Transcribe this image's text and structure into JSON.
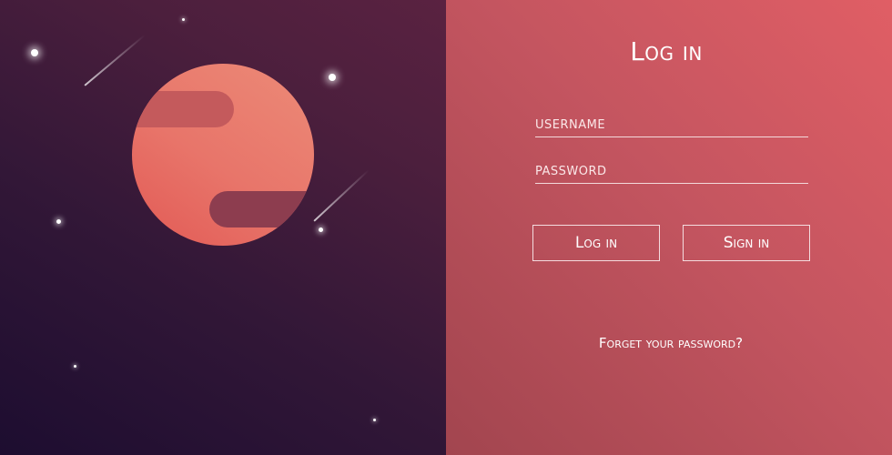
{
  "login_form": {
    "title": "Log in",
    "username_placeholder": "USERNAME",
    "password_placeholder": "PASSWORD",
    "login_button": "Log in",
    "signin_button": "Sign in",
    "forgot_link": "Forget your password?"
  },
  "colors": {
    "left_panel_dark": "#1d0d30",
    "left_panel_light": "#5a2241",
    "right_panel_light": "#e05e65",
    "right_panel_dark": "#a2454f",
    "planet": "#e8756a"
  }
}
